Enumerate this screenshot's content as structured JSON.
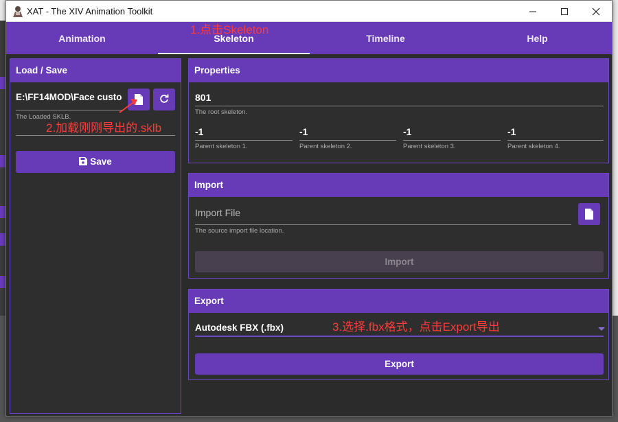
{
  "window": {
    "title": "XAT - The XIV Animation Toolkit"
  },
  "tabs": [
    {
      "label": "Animation"
    },
    {
      "label": "Skeleton"
    },
    {
      "label": "Timeline"
    },
    {
      "label": "Help"
    }
  ],
  "load_save": {
    "header": "Load / Save",
    "path_value": "E:\\FF14MOD\\Face custo",
    "path_hint": "The Loaded SKLB.",
    "save_label": "Save"
  },
  "properties": {
    "header": "Properties",
    "root_value": "801",
    "root_hint": "The root skeleton.",
    "parents": [
      {
        "value": "-1",
        "hint": "Parent skeleton 1."
      },
      {
        "value": "-1",
        "hint": "Parent skeleton 2."
      },
      {
        "value": "-1",
        "hint": "Parent skeleton 3."
      },
      {
        "value": "-1",
        "hint": "Parent skeleton 4."
      }
    ]
  },
  "import": {
    "header": "Import",
    "file_placeholder": "Import File",
    "file_hint": "The source import file location.",
    "button_label": "Import"
  },
  "export": {
    "header": "Export",
    "format_selected": "Autodesk FBX (.fbx)",
    "button_label": "Export"
  },
  "annotations": {
    "step1": "1.点击Skeleton",
    "step2": "2.加载刚刚导出的.sklb",
    "step3": "3.选择.fbx格式，点击Export导出"
  },
  "colors": {
    "accent": "#673ab7",
    "panel": "#2e2e2e",
    "annotation": "#ff3b3b"
  },
  "icons": [
    "file-icon",
    "refresh-icon",
    "save-icon",
    "dropdown-arrow-icon",
    "minimize-icon",
    "maximize-icon",
    "close-icon"
  ]
}
